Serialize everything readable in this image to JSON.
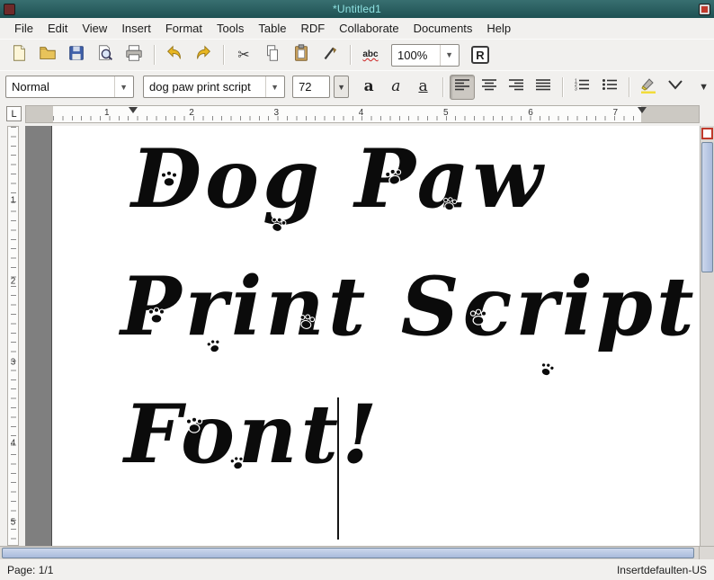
{
  "window": {
    "title": "*Untitled1"
  },
  "menu": {
    "items": [
      "File",
      "Edit",
      "View",
      "Insert",
      "Format",
      "Tools",
      "Table",
      "RDF",
      "Collaborate",
      "Documents",
      "Help"
    ]
  },
  "toolbar": {
    "zoom": "100%",
    "spellcheck_label": "abc",
    "rdf_label": "R",
    "icons": [
      "new-document",
      "open",
      "save",
      "print-preview",
      "print",
      "undo",
      "redo",
      "cut",
      "copy",
      "paste",
      "pen",
      "spellcheck",
      "zoom-select",
      "rdf"
    ]
  },
  "formatbar": {
    "style": "Normal",
    "font": "dog paw print script",
    "size": "72",
    "bold_label": "a",
    "italic_label": "a",
    "underline_label": "a",
    "icons": [
      "bold",
      "italic",
      "underline",
      "align-left",
      "align-center",
      "align-right",
      "align-justify",
      "numbered-list",
      "bullet-list",
      "highlight",
      "more-chevron",
      "overflow-arrow"
    ]
  },
  "ruler": {
    "corner_label": "L",
    "h_numbers": [
      "1",
      "2",
      "3",
      "4",
      "5",
      "6",
      "7"
    ],
    "v_numbers": [
      "1",
      "2",
      "3",
      "4",
      "5"
    ]
  },
  "document": {
    "lines": [
      "Dog Paw",
      "Print Script",
      "Font!"
    ]
  },
  "statusbar": {
    "page": "Page: 1/1",
    "right": "Insertdefaulten-US"
  },
  "colors": {
    "titlebar": "#25595b",
    "titlebar_text": "#8fe2e2",
    "scrollbar_thumb": "#aebedd",
    "close_button": "#c0392b"
  }
}
